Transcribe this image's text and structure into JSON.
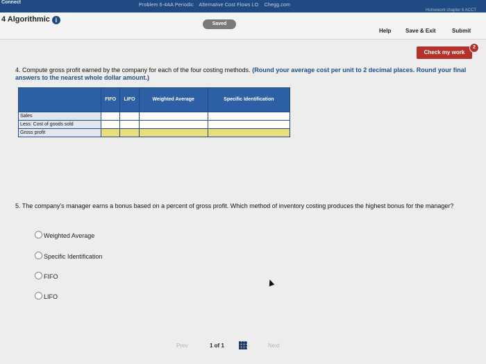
{
  "topbar": {
    "brand": "Connect",
    "tabs": [
      "Problem 6-4AA Periodic",
      "Alternative Cost Flows LO",
      "Chegg.com"
    ],
    "homework": "Homework chapter 6 ACCT"
  },
  "header": {
    "title": "4 Algorithmic",
    "saved": "Saved",
    "help": "Help",
    "save_exit": "Save & Exit",
    "submit": "Submit"
  },
  "check_work": {
    "label": "Check my work",
    "badge": "2"
  },
  "q4": {
    "text": "4. Compute gross profit earned by the company for each of the four costing methods.",
    "instruction": "(Round your average cost per unit to 2 decimal places. Round your final answers to the nearest whole dollar amount.)"
  },
  "table": {
    "columns": [
      "FIFO",
      "LIFO",
      "Weighted Average",
      "Specific Identification"
    ],
    "rows": [
      "Sales",
      "Less: Cost of goods sold",
      "Gross profit"
    ]
  },
  "q5": {
    "text": "5. The company's manager earns a bonus based on a percent of gross profit. Which method of inventory costing produces the highest bonus for the manager?",
    "options": [
      "Weighted Average",
      "Specific Identification",
      "FIFO",
      "LIFO"
    ]
  },
  "footer": {
    "prev": "Prev",
    "page": "1 of 1",
    "next": "Next"
  }
}
